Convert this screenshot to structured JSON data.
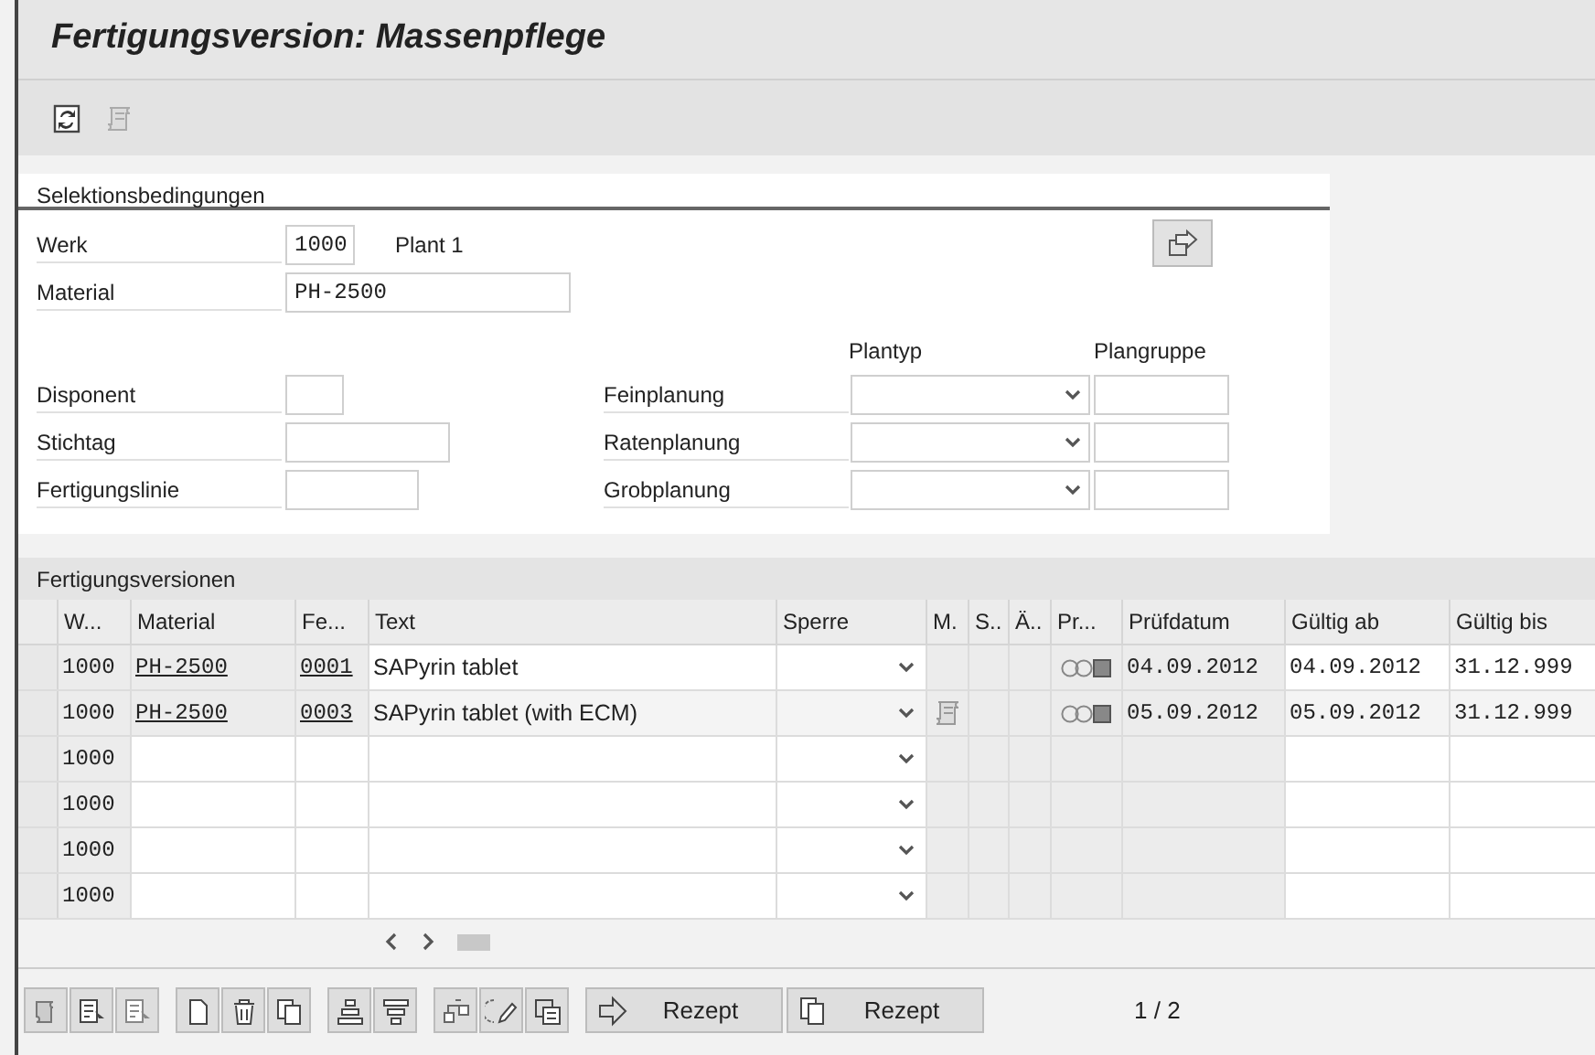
{
  "window": {
    "title": "Fertigungsversion: Massenpflege"
  },
  "selection": {
    "title": "Selektionsbedingungen",
    "fields": [
      {
        "label": "Werk",
        "value": "1000",
        "description": "Plant 1"
      },
      {
        "label": "Material",
        "value": "PH-2500"
      },
      {
        "label": "Disponent"
      },
      {
        "label": "Stichtag"
      },
      {
        "label": "Fertigungslinie"
      }
    ],
    "planning": {
      "column_1": "Plantyp",
      "column_2": "Plangruppe",
      "rows": [
        {
          "label": "Feinplanung"
        },
        {
          "label": "Ratenplanung"
        },
        {
          "label": "Grobplanung"
        }
      ]
    }
  },
  "table": {
    "title": "Fertigungsversionen",
    "columns": [
      "W...",
      "Material",
      "Fe...",
      "Text",
      "Sperre",
      "M.",
      "S..",
      "Ä..",
      "Pr...",
      "Prüfdatum",
      "Gültig ab",
      "Gültig bis"
    ],
    "rows": [
      {
        "werk": "1000",
        "material": "PH-2500",
        "version": "0001",
        "text": "SAPyrin tablet",
        "document": false,
        "status_light": true,
        "pruefdatum": "04.09.2012",
        "gueltig_ab": "04.09.2012",
        "gueltig_bis": "31.12.999"
      },
      {
        "werk": "1000",
        "material": "PH-2500",
        "version": "0003",
        "text": "SAPyrin tablet (with ECM)",
        "document": true,
        "status_light": true,
        "pruefdatum": "05.09.2012",
        "gueltig_ab": "05.09.2012",
        "gueltig_bis": "31.12.999"
      },
      {
        "werk": "1000",
        "document": false,
        "status_light": false
      },
      {
        "werk": "1000",
        "document": false,
        "status_light": false
      },
      {
        "werk": "1000",
        "document": false,
        "status_light": false
      },
      {
        "werk": "1000",
        "document": false,
        "status_light": false
      }
    ]
  },
  "bottom_toolbar": {
    "buttons": [
      {
        "kind": "forward",
        "label": "Rezept"
      },
      {
        "kind": "copy",
        "label": "Rezept"
      }
    ],
    "page": "1 / 2"
  }
}
